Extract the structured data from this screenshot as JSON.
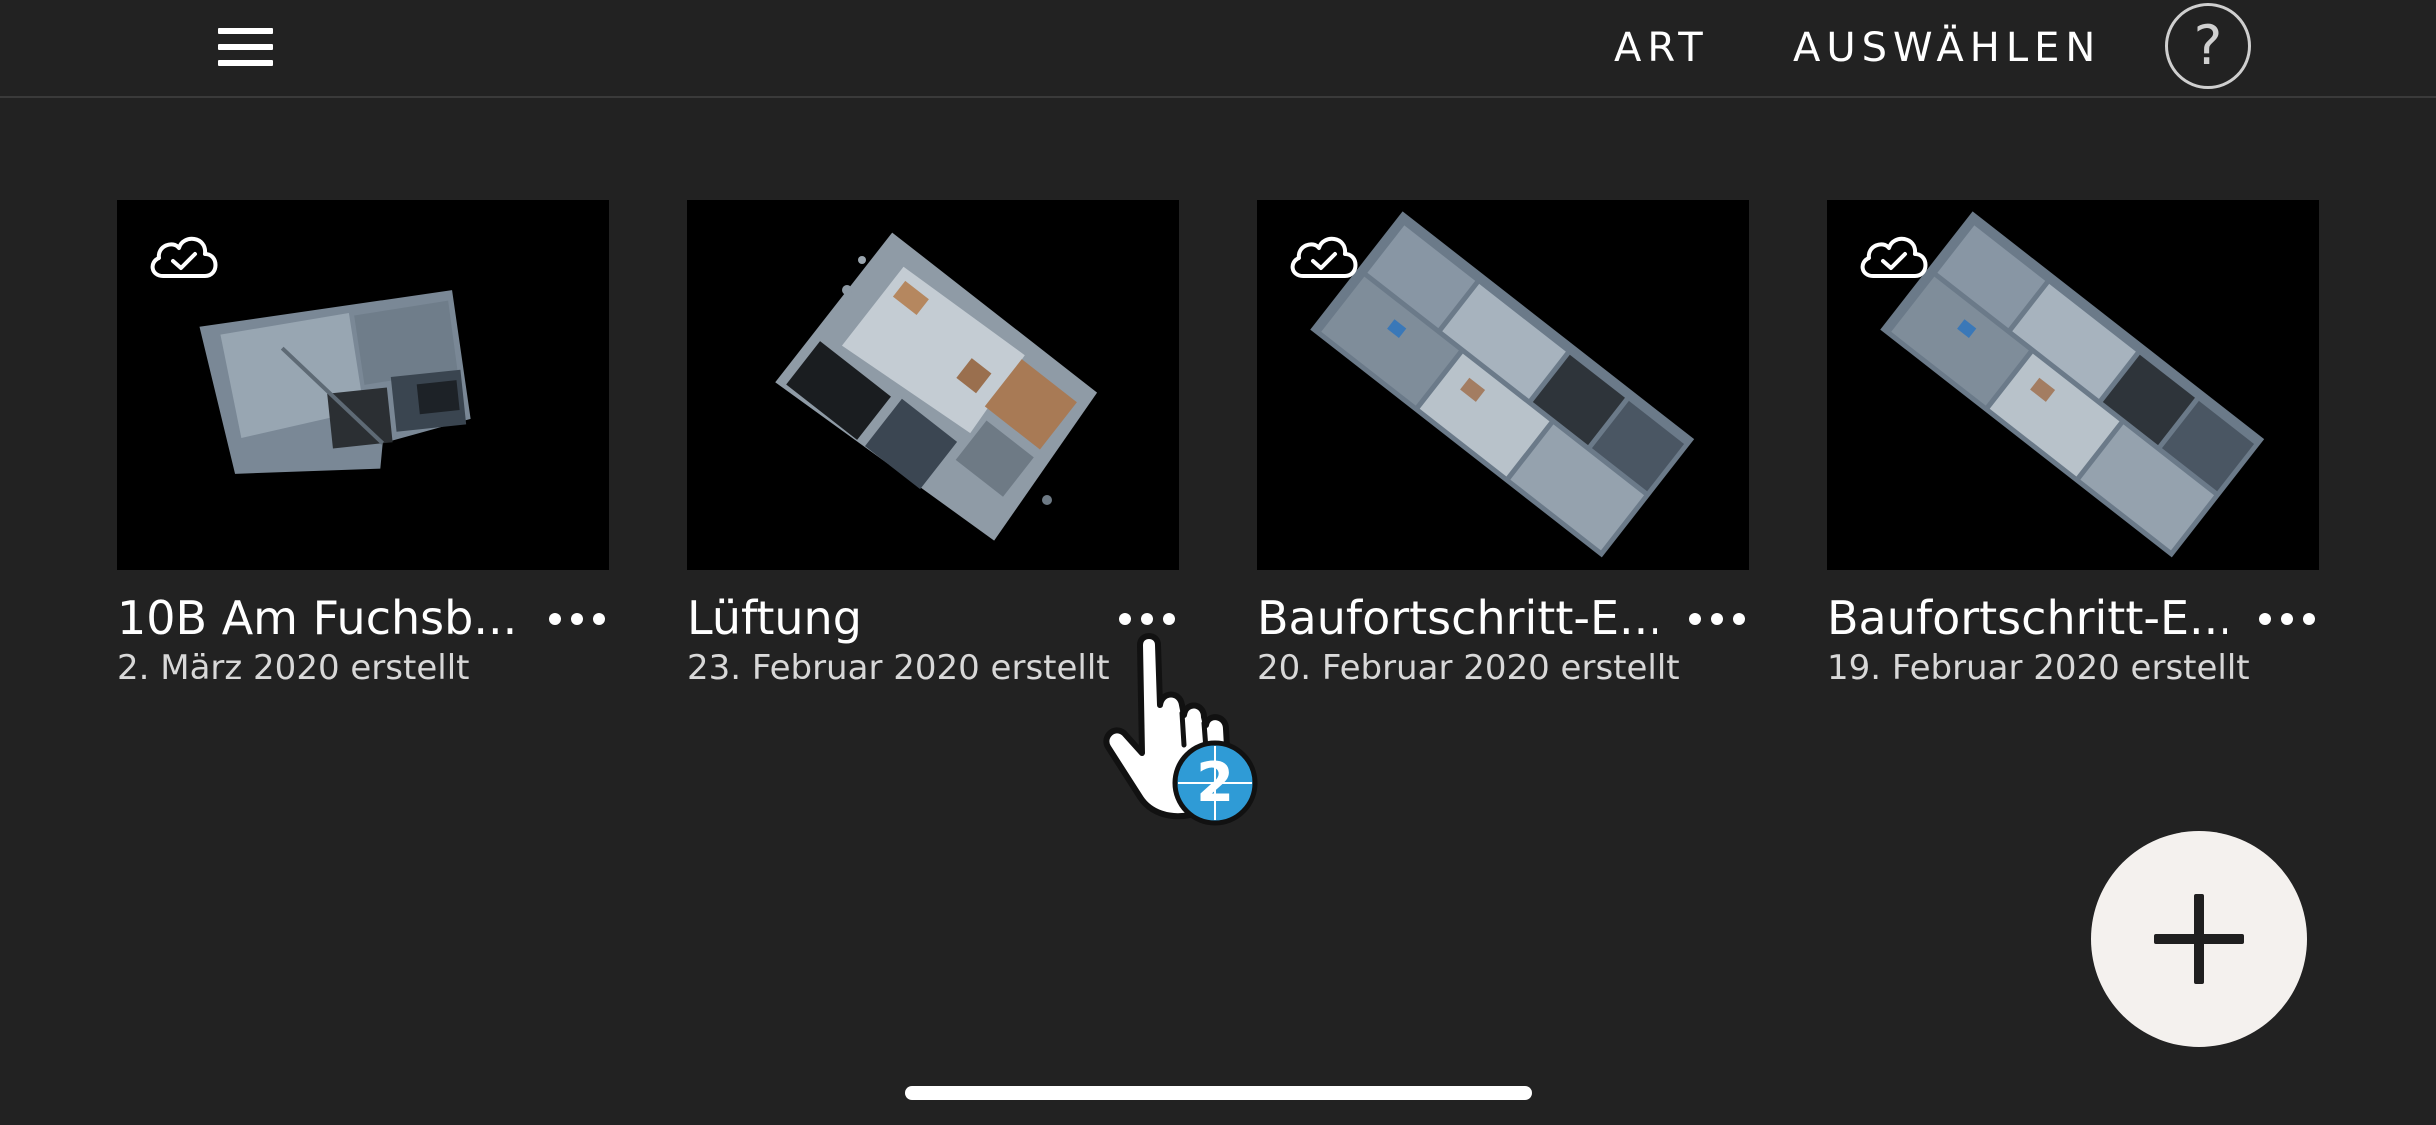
{
  "topbar": {
    "menu_icon": "hamburger-menu-icon",
    "type_label": "ART",
    "select_label": "AUSWÄHLEN",
    "help_label": "?"
  },
  "cards": [
    {
      "title": "10B Am Fuchsb...",
      "date": "2. März 2020 erstellt",
      "synced": true,
      "icon": "cloud-check-icon"
    },
    {
      "title": "Lüftung",
      "date": "23. Februar 2020 erstellt",
      "synced": false
    },
    {
      "title": "Baufortschritt-E...",
      "date": "20. Februar 2020 erstellt",
      "synced": true,
      "icon": "cloud-check-icon"
    },
    {
      "title": "Baufortschritt-E...",
      "date": "19. Februar 2020 erstellt",
      "synced": true,
      "icon": "cloud-check-icon"
    }
  ],
  "tutorial": {
    "step": "2",
    "icon": "tap-hand-icon"
  },
  "fab": {
    "icon": "plus-icon"
  },
  "colors": {
    "background": "#222222",
    "text": "#ffffff",
    "fab": "#f4f1ee",
    "tutorial_badge": "#2f9bd6"
  }
}
